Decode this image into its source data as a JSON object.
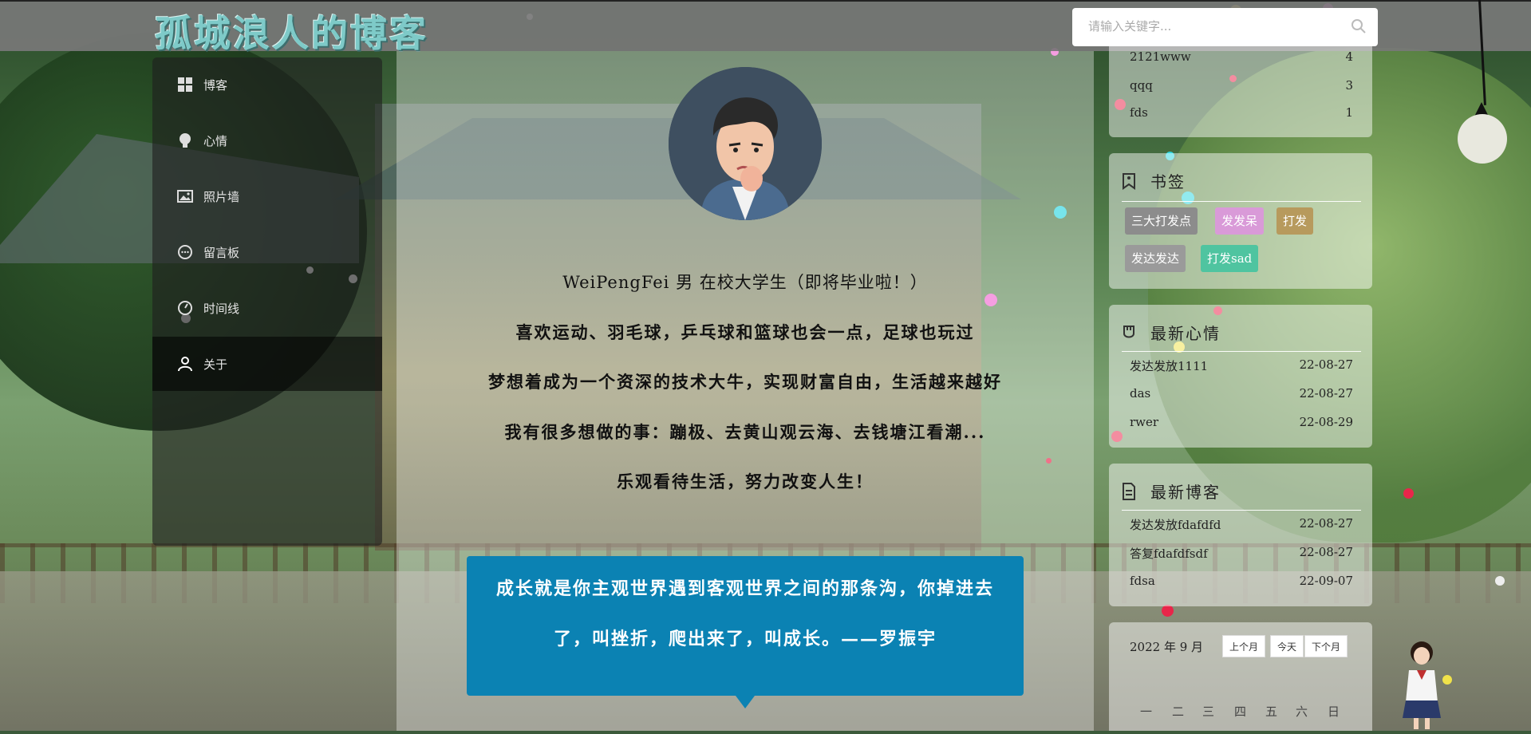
{
  "header": {
    "logo": "孤城浪人的博客",
    "search_placeholder": "请输入关键字..."
  },
  "nav": {
    "items": [
      {
        "label": "博客",
        "icon": "grid-icon"
      },
      {
        "label": "心情",
        "icon": "bulb-icon"
      },
      {
        "label": "照片墙",
        "icon": "image-icon"
      },
      {
        "label": "留言板",
        "icon": "chat-icon"
      },
      {
        "label": "时间线",
        "icon": "clock-icon"
      },
      {
        "label": "关于",
        "icon": "user-icon",
        "active": true
      }
    ]
  },
  "about": {
    "lines": [
      "WeiPengFei 男 在校大学生（即将毕业啦！）",
      "喜欢运动、羽毛球，乒乓球和篮球也会一点，足球也玩过",
      "梦想着成为一个资深的技术大牛，实现财富自由，生活越来越好",
      "我有很多想做的事：蹦极、去黄山观云海、去钱塘江看潮...",
      "乐观看待生活，努力改变人生！"
    ],
    "quote_line1": "成长就是你主观世界遇到客观世界之间的那条沟，你掉进去",
    "quote_line2": "了，叫挫折，爬出来了，叫成长。——罗振宇"
  },
  "categories": {
    "rows": [
      {
        "name": "2121www",
        "count": "4"
      },
      {
        "name": "qqq",
        "count": "3"
      },
      {
        "name": "fds",
        "count": "1"
      }
    ]
  },
  "bookmarks": {
    "title": "书签",
    "tags": [
      {
        "label": "三大打发点",
        "color": "#8c8c8c"
      },
      {
        "label": "发发呆",
        "color": "#d99ad8"
      },
      {
        "label": "打发",
        "color": "#b79a5d"
      },
      {
        "label": "发达发达",
        "color": "#9a9a9a"
      },
      {
        "label": "打发sad",
        "color": "#4fc4a0"
      }
    ]
  },
  "moods": {
    "title": "最新心情",
    "rows": [
      {
        "text": "发达发放1111",
        "date": "22-08-27"
      },
      {
        "text": "das",
        "date": "22-08-27"
      },
      {
        "text": "rwer",
        "date": "22-08-29"
      }
    ]
  },
  "blogs": {
    "title": "最新博客",
    "rows": [
      {
        "text": "发达发放fdafdfd",
        "date": "22-08-27"
      },
      {
        "text": "答复fdafdfsdf",
        "date": "22-08-27"
      },
      {
        "text": "fdsa",
        "date": "22-09-07"
      }
    ]
  },
  "calendar": {
    "month_label": "2022 年 9 月",
    "prev": "上个月",
    "today": "今天",
    "next": "下个月",
    "weekdays": [
      "一",
      "二",
      "三",
      "四",
      "五",
      "六",
      "日"
    ]
  }
}
